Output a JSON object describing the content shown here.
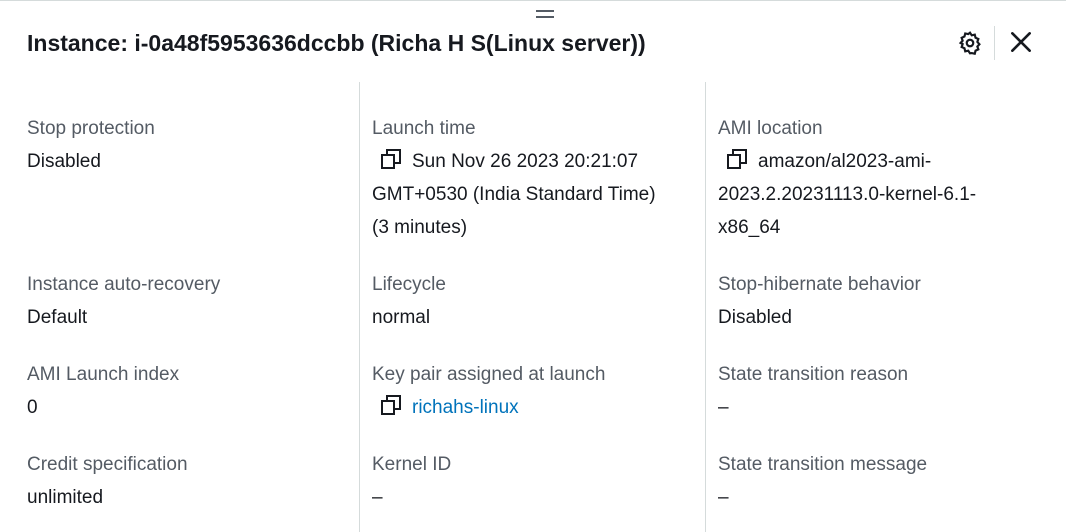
{
  "header": {
    "title": "Instance: i-0a48f5953636dccbb (Richa H S(Linux server))",
    "icons": {
      "settings": "gear-icon",
      "close": "close-icon",
      "drag": "drag-handle-icon"
    }
  },
  "columns": [
    [
      {
        "label": "Stop protection",
        "value": "Disabled"
      },
      {
        "label": "Instance auto-recovery",
        "value": "Default"
      },
      {
        "label": "AMI Launch index",
        "value": "0"
      },
      {
        "label": "Credit specification",
        "value": "unlimited"
      }
    ],
    [
      {
        "label": "Launch time",
        "value_line1": "Sun Nov 26 2023 20:21:07",
        "value_line2": "GMT+0530 (India Standard Time)",
        "value_line3": "(3 minutes)"
      },
      {
        "label": "Lifecycle",
        "value": "normal"
      },
      {
        "label": "Key pair assigned at launch",
        "value": "richahs-linux"
      },
      {
        "label": "Kernel ID",
        "value": "–"
      }
    ],
    [
      {
        "label": "AMI location",
        "value_line1": "amazon/al2023-ami-",
        "value_line2": "2023.2.20231113.0-kernel-6.1-",
        "value_line3": "x86_64"
      },
      {
        "label": "Stop-hibernate behavior",
        "value": "Disabled"
      },
      {
        "label": "State transition reason",
        "value": "–"
      },
      {
        "label": "State transition message",
        "value": "–"
      }
    ]
  ],
  "colors": {
    "label": "#545b64",
    "value": "#16191f",
    "link": "#0073bb",
    "divider": "#d5dbdb"
  }
}
